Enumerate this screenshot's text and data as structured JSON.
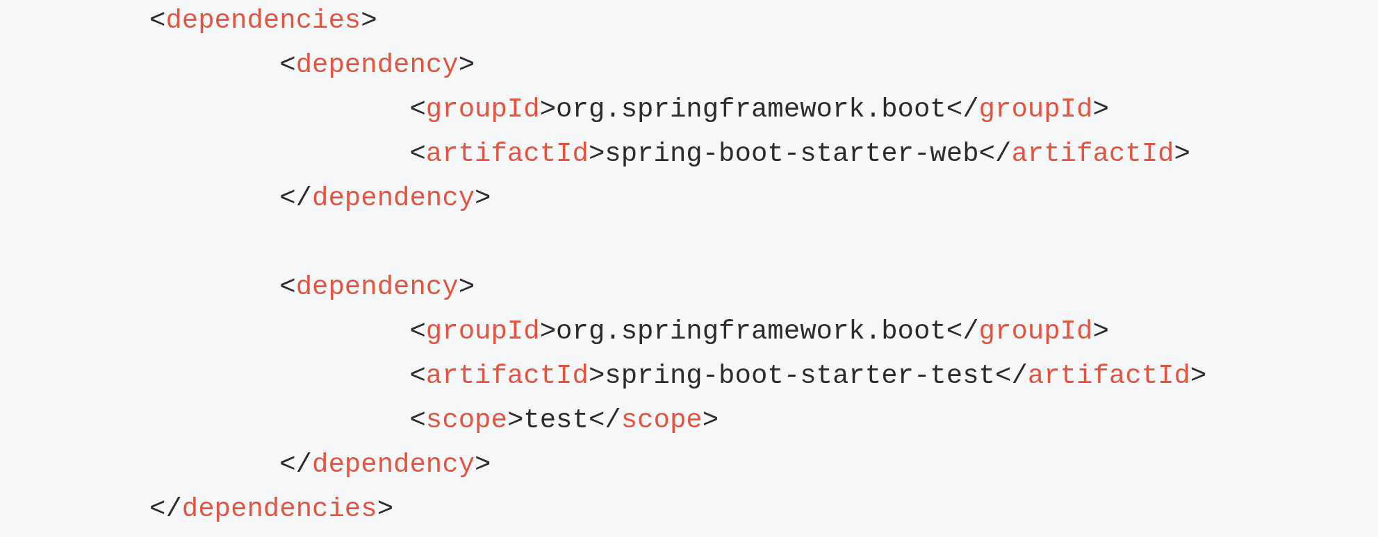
{
  "code": [
    {
      "kind": "element",
      "open": [
        {
          "kind": "punct",
          "text": "<"
        },
        {
          "kind": "tag",
          "text": "dependencies"
        },
        {
          "kind": "punct",
          "text": ">"
        }
      ],
      "close": [
        {
          "kind": "punct",
          "text": "</"
        },
        {
          "kind": "tag",
          "text": "dependencies"
        },
        {
          "kind": "punct",
          "text": ">"
        }
      ],
      "children": [
        {
          "kind": "element",
          "open": [
            {
              "kind": "punct",
              "text": "<"
            },
            {
              "kind": "tag",
              "text": "dependency"
            },
            {
              "kind": "punct",
              "text": ">"
            }
          ],
          "close": [
            {
              "kind": "punct",
              "text": "</"
            },
            {
              "kind": "tag",
              "text": "dependency"
            },
            {
              "kind": "punct",
              "text": ">"
            }
          ],
          "children": [
            {
              "kind": "line",
              "tokens": [
                {
                  "kind": "punct",
                  "text": "<"
                },
                {
                  "kind": "tag",
                  "text": "groupId"
                },
                {
                  "kind": "punct",
                  "text": ">"
                },
                {
                  "kind": "text",
                  "text": "org.springframework.boot"
                },
                {
                  "kind": "punct",
                  "text": "</"
                },
                {
                  "kind": "tag",
                  "text": "groupId"
                },
                {
                  "kind": "punct",
                  "text": ">"
                }
              ]
            },
            {
              "kind": "line",
              "tokens": [
                {
                  "kind": "punct",
                  "text": "<"
                },
                {
                  "kind": "tag",
                  "text": "artifactId"
                },
                {
                  "kind": "punct",
                  "text": ">"
                },
                {
                  "kind": "text",
                  "text": "spring-boot-starter-web"
                },
                {
                  "kind": "punct",
                  "text": "</"
                },
                {
                  "kind": "tag",
                  "text": "artifactId"
                },
                {
                  "kind": "punct",
                  "text": ">"
                }
              ]
            }
          ]
        },
        {
          "kind": "blank"
        },
        {
          "kind": "element",
          "open": [
            {
              "kind": "punct",
              "text": "<"
            },
            {
              "kind": "tag",
              "text": "dependency"
            },
            {
              "kind": "punct",
              "text": ">"
            }
          ],
          "close": [
            {
              "kind": "punct",
              "text": "</"
            },
            {
              "kind": "tag",
              "text": "dependency"
            },
            {
              "kind": "punct",
              "text": ">"
            }
          ],
          "children": [
            {
              "kind": "line",
              "tokens": [
                {
                  "kind": "punct",
                  "text": "<"
                },
                {
                  "kind": "tag",
                  "text": "groupId"
                },
                {
                  "kind": "punct",
                  "text": ">"
                },
                {
                  "kind": "text",
                  "text": "org.springframework.boot"
                },
                {
                  "kind": "punct",
                  "text": "</"
                },
                {
                  "kind": "tag",
                  "text": "groupId"
                },
                {
                  "kind": "punct",
                  "text": ">"
                }
              ]
            },
            {
              "kind": "line",
              "tokens": [
                {
                  "kind": "punct",
                  "text": "<"
                },
                {
                  "kind": "tag",
                  "text": "artifactId"
                },
                {
                  "kind": "punct",
                  "text": ">"
                },
                {
                  "kind": "text",
                  "text": "spring-boot-starter-test"
                },
                {
                  "kind": "punct",
                  "text": "</"
                },
                {
                  "kind": "tag",
                  "text": "artifactId"
                },
                {
                  "kind": "punct",
                  "text": ">"
                }
              ]
            },
            {
              "kind": "line",
              "tokens": [
                {
                  "kind": "punct",
                  "text": "<"
                },
                {
                  "kind": "tag",
                  "text": "scope"
                },
                {
                  "kind": "punct",
                  "text": ">"
                },
                {
                  "kind": "text",
                  "text": "test"
                },
                {
                  "kind": "punct",
                  "text": "</"
                },
                {
                  "kind": "tag",
                  "text": "scope"
                },
                {
                  "kind": "punct",
                  "text": ">"
                }
              ]
            }
          ]
        }
      ]
    }
  ]
}
